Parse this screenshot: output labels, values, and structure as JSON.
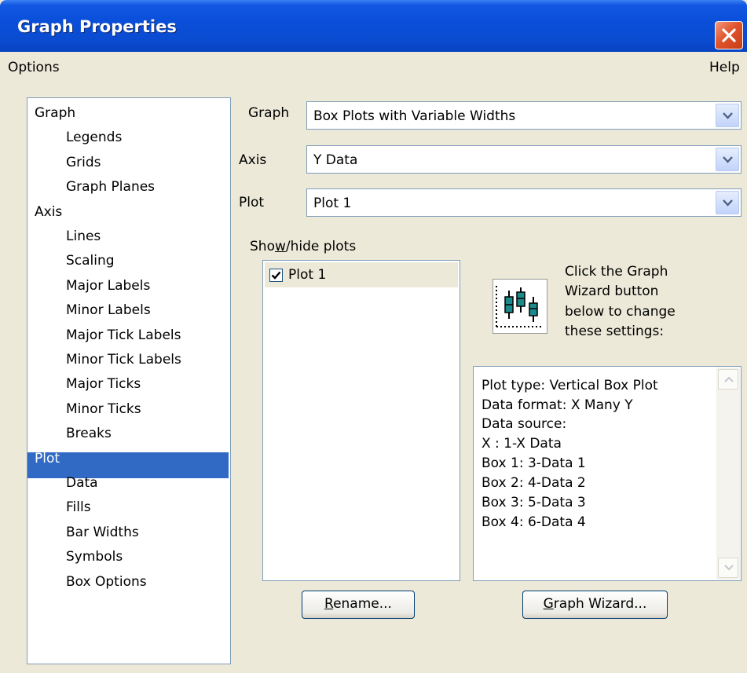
{
  "window": {
    "title": "Graph Properties"
  },
  "menu": {
    "options": "Options",
    "help": "Help"
  },
  "tree": {
    "items": [
      {
        "label": "Graph",
        "level": 0
      },
      {
        "label": "Legends",
        "level": 1
      },
      {
        "label": "Grids",
        "level": 1
      },
      {
        "label": "Graph Planes",
        "level": 1
      },
      {
        "label": "Axis",
        "level": 0
      },
      {
        "label": "Lines",
        "level": 1
      },
      {
        "label": "Scaling",
        "level": 1
      },
      {
        "label": "Major Labels",
        "level": 1
      },
      {
        "label": "Minor Labels",
        "level": 1
      },
      {
        "label": "Major Tick Labels",
        "level": 1
      },
      {
        "label": "Minor Tick Labels",
        "level": 1
      },
      {
        "label": "Major Ticks",
        "level": 1
      },
      {
        "label": "Minor Ticks",
        "level": 1
      },
      {
        "label": "Breaks",
        "level": 1
      },
      {
        "label": "Plot",
        "level": 0,
        "selected": true
      },
      {
        "label": "Data",
        "level": 1
      },
      {
        "label": "Fills",
        "level": 1
      },
      {
        "label": "Bar Widths",
        "level": 1
      },
      {
        "label": "Symbols",
        "level": 1
      },
      {
        "label": "Box Options",
        "level": 1
      }
    ]
  },
  "fields": {
    "graph_label": "Graph",
    "graph_value": "Box Plots with Variable Widths",
    "axis_label": "Axis",
    "axis_value": "Y Data",
    "plot_label": "Plot",
    "plot_value": "Plot 1"
  },
  "showhide": {
    "label_pre": "Sho",
    "label_mnemonic": "w",
    "label_post": "/hide plots",
    "plots": [
      {
        "name": "Plot 1",
        "checked": true
      }
    ]
  },
  "wizard_hint": [
    "Click the Graph",
    "Wizard button",
    "below to change",
    "these settings:"
  ],
  "plot_info": [
    "Plot type: Vertical Box Plot",
    "Data format: X Many Y",
    "Data source:",
    "X : 1-X Data",
    "Box 1: 3-Data 1",
    "Box 2: 4-Data 2",
    "Box 3: 5-Data 3",
    "Box 4: 6-Data 4"
  ],
  "buttons": {
    "rename_mnemonic": "R",
    "rename_rest": "ename...",
    "wizard_mnemonic": "G",
    "wizard_rest": "raph Wizard..."
  },
  "colors": {
    "selection": "#316ac5",
    "titlebar": "#0a4fd9",
    "box_fill": "#1a8a8a"
  },
  "icons": {
    "close": "close-icon",
    "dropdown": "chevron-down-icon",
    "graph": "box-plot-icon"
  }
}
